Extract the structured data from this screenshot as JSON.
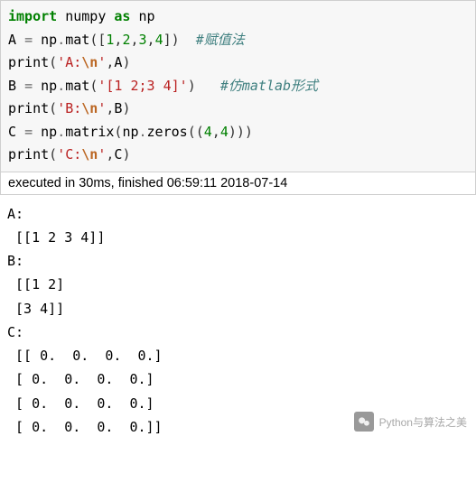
{
  "code": {
    "l1": {
      "kw1": "import",
      "mod": "numpy",
      "kw2": "as",
      "alias": "np"
    },
    "l2": {
      "v": "A",
      "eq": "=",
      "np": "np",
      "dot1": ".",
      "fn": "mat",
      "o": "(",
      "ob": "[",
      "n1": "1",
      "c": ",",
      "n2": "2",
      "n3": "3",
      "n4": "4",
      "cb": "]",
      "cp": ")",
      "cmt": "#赋值法"
    },
    "l3": {
      "fn": "print",
      "o": "(",
      "s1a": "'",
      "s1b": "A:",
      "esc": "\\n",
      "s1c": "'",
      "c": ",",
      "v": "A",
      "cp": ")"
    },
    "l4": {
      "v": "B",
      "eq": "=",
      "np": "np",
      "dot1": ".",
      "fn": "mat",
      "o": "(",
      "s": "'[1 2;3 4]'",
      "cp": ")",
      "cmt": "#仿matlab形式"
    },
    "l5": {
      "fn": "print",
      "o": "(",
      "s1a": "'",
      "s1b": "B:",
      "esc": "\\n",
      "s1c": "'",
      "c": ",",
      "v": "B",
      "cp": ")"
    },
    "l6": {
      "v": "C",
      "eq": "=",
      "np": "np",
      "dot1": ".",
      "fn1": "matrix",
      "o1": "(",
      "np2": "np",
      "dot2": ".",
      "fn2": "zeros",
      "o2": "(",
      "o3": "(",
      "n1": "4",
      "c": ",",
      "n2": "4",
      "c3": ")",
      "c2": ")",
      "c1": ")"
    },
    "l7": {
      "fn": "print",
      "o": "(",
      "s1a": "'",
      "s1b": "C:",
      "esc": "\\n",
      "s1c": "'",
      "c": ",",
      "v": "C",
      "cp": ")"
    }
  },
  "exec": "executed in 30ms, finished 06:59:11 2018-07-14",
  "output": "A:\n [[1 2 3 4]]\nB:\n [[1 2]\n [3 4]]\nC:\n [[ 0.  0.  0.  0.]\n [ 0.  0.  0.  0.]\n [ 0.  0.  0.  0.]\n [ 0.  0.  0.  0.]]",
  "watermark": "Python与算法之美"
}
